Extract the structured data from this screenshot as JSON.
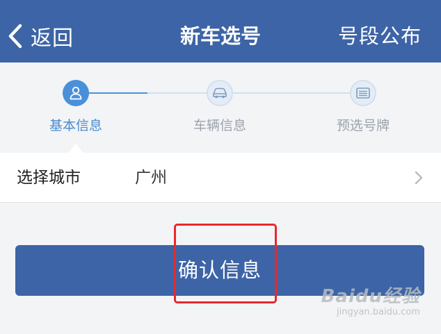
{
  "nav": {
    "back_label": "返回",
    "title": "新车选号",
    "right_label": "号段公布",
    "background_color": "#3d64a6"
  },
  "steps": [
    {
      "label": "基本信息",
      "icon": "user-icon",
      "state": "active"
    },
    {
      "label": "车辆信息",
      "icon": "car-icon",
      "state": "inactive"
    },
    {
      "label": "预选号牌",
      "icon": "license-plate-icon",
      "state": "inactive"
    }
  ],
  "form": {
    "city_label": "选择城市",
    "city_value": "广州"
  },
  "confirm_button": {
    "label": "确认信息",
    "background_color": "#3d64a6"
  },
  "annotation": {
    "highlight_color": "#e8282c"
  },
  "watermark": {
    "logo": "Baidu经验",
    "url": "jingyan.baidu.com"
  },
  "colors": {
    "active_step": "#4a90d9",
    "page_background": "#f3f4f6"
  }
}
